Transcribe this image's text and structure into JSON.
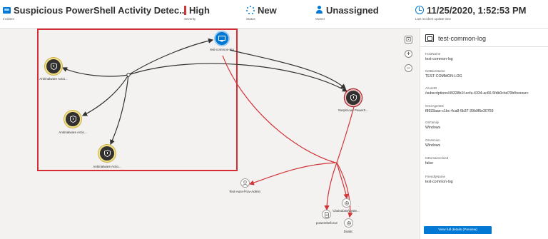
{
  "header": {
    "incident": {
      "title": "Suspicious PowerShell Activity Detec...",
      "label": "Incident"
    },
    "severity": {
      "value": "High",
      "label": "Severity"
    },
    "status": {
      "value": "New",
      "label": "Status"
    },
    "owner": {
      "value": "Unassigned",
      "label": "Owner"
    },
    "updated": {
      "value": "11/25/2020, 1:52:53 PM",
      "label": "Last incident update time"
    }
  },
  "graph": {
    "nodes": {
      "host": "test-common-log",
      "alert_1": "Antimalware Actio...",
      "alert_2": "Antimalware Actio...",
      "alert_3": "Antimalware Actio...",
      "suspicious": "Suspicious PowerS...",
      "account": "Test-Auto-Prov-Admin",
      "process_1": "\\c\\windows\\syste...",
      "file": "powershell.exe",
      "process_2": "Dsabc"
    },
    "zoom": {
      "fit": "⊡",
      "in": "+",
      "out": "−"
    }
  },
  "panel": {
    "title": "test-common-log",
    "fields": [
      {
        "label": "HostName",
        "value": "test-common-log"
      },
      {
        "label": "NetBiosName",
        "value": "TEST-COMMON-LOG"
      },
      {
        "label": "AzureID",
        "value": "/subscriptions/49328b1f-ecfa-4334-ac66-5fdb0cbd70bf/resourc"
      },
      {
        "label": "OmsAgentID",
        "value": "f8933aae-c1bc-4ca8-6b37-39b9f5e30759"
      },
      {
        "label": "OsFamily",
        "value": "Windows"
      },
      {
        "label": "OsVersion",
        "value": "Windows"
      },
      {
        "label": "IsDomainJoined",
        "value": "false"
      },
      {
        "label": "FriendlyName",
        "value": "test-common-log"
      }
    ],
    "button_label": "View full details (Preview)"
  },
  "colors": {
    "accent": "#0078d4",
    "severity_high": "#d13438",
    "selection_border": "#d62d34",
    "alert_ring": "#f4e38b",
    "edge_red": "#d13438",
    "edge_black": "#323130"
  },
  "icons": {
    "incident": "incident-icon",
    "severity": "severity-bar-icon",
    "status": "status-spinner-icon",
    "owner": "user-icon",
    "updated": "clock-icon",
    "alert": "shield-icon",
    "host": "computer-icon",
    "account": "person-icon",
    "process": "gear-icon",
    "file": "file-icon"
  }
}
